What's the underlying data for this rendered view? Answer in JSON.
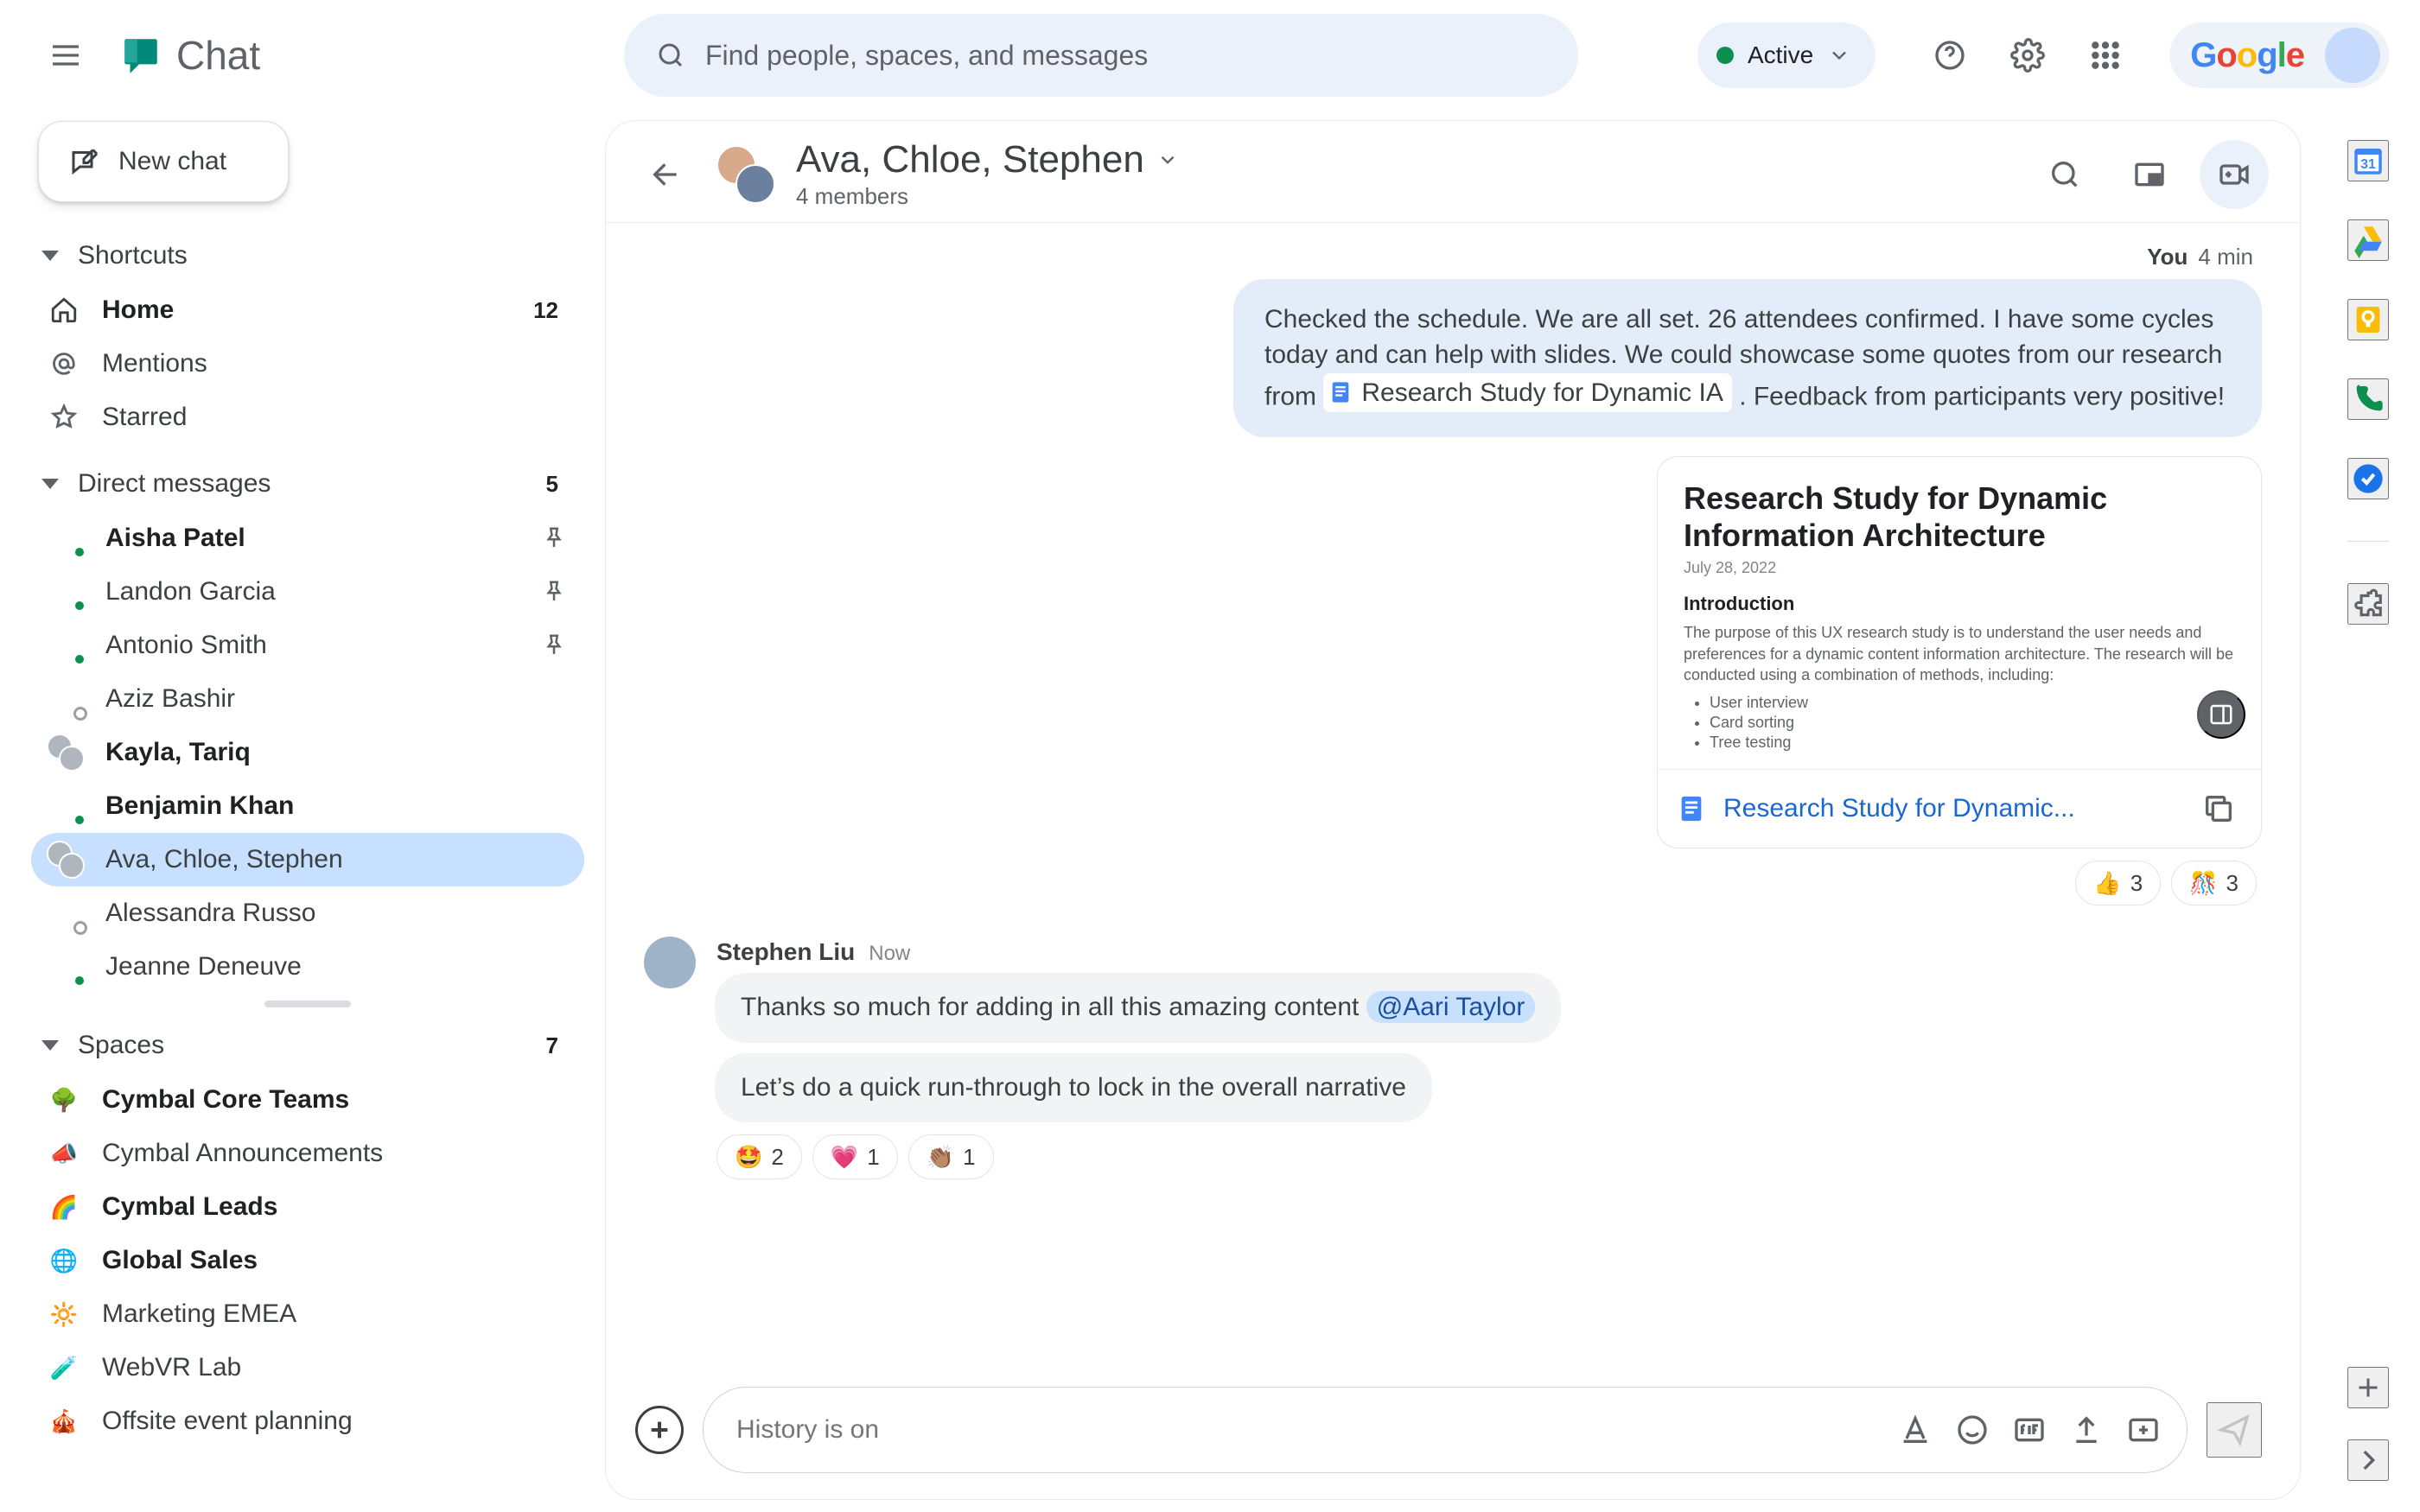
{
  "app_title": "Chat",
  "search": {
    "placeholder": "Find people, spaces, and messages"
  },
  "status": {
    "label": "Active"
  },
  "new_chat_label": "New chat",
  "sections": {
    "shortcuts": {
      "label": "Shortcuts"
    },
    "home": {
      "label": "Home",
      "count": "12"
    },
    "mentions": {
      "label": "Mentions"
    },
    "starred": {
      "label": "Starred"
    },
    "dms": {
      "label": "Direct messages",
      "count": "5"
    },
    "spaces": {
      "label": "Spaces",
      "count": "7"
    }
  },
  "dms": [
    {
      "name": "Aisha Patel",
      "presence": "online",
      "bold": true,
      "pinned": true
    },
    {
      "name": "Landon Garcia",
      "presence": "online",
      "bold": false,
      "pinned": true
    },
    {
      "name": "Antonio Smith",
      "presence": "online",
      "bold": false,
      "pinned": true
    },
    {
      "name": "Aziz Bashir",
      "presence": "offline",
      "bold": false,
      "pinned": false
    },
    {
      "name": "Kayla, Tariq",
      "presence": "pair",
      "bold": true,
      "pinned": false
    },
    {
      "name": "Benjamin Khan",
      "presence": "online",
      "bold": true,
      "pinned": false
    },
    {
      "name": "Ava, Chloe, Stephen",
      "presence": "pair",
      "bold": false,
      "pinned": false,
      "active": true
    },
    {
      "name": "Alessandra Russo",
      "presence": "offline",
      "bold": false,
      "pinned": false
    },
    {
      "name": "Jeanne Deneuve",
      "presence": "online",
      "bold": false,
      "pinned": false
    }
  ],
  "spaces": [
    {
      "name": "Cymbal Core Teams",
      "emoji": "🌳",
      "bold": true
    },
    {
      "name": "Cymbal Announcements",
      "emoji": "📣",
      "bold": false
    },
    {
      "name": "Cymbal Leads",
      "emoji": "🌈",
      "bold": true
    },
    {
      "name": "Global Sales",
      "emoji": "🌐",
      "bold": true
    },
    {
      "name": "Marketing EMEA",
      "emoji": "🔆",
      "bold": false
    },
    {
      "name": "WebVR Lab",
      "emoji": "🧪",
      "bold": false
    },
    {
      "name": "Offsite event planning",
      "emoji": "🎪",
      "bold": false
    }
  ],
  "conversation": {
    "title": "Ava, Chloe, Stephen",
    "subtitle": "4 members",
    "you_label": "You",
    "you_time": "4 min",
    "you_text_before": "Checked the schedule.  We are all set.  26 attendees confirmed. I have some cycles today and can help with slides.  We could showcase some quotes from our research from ",
    "you_chip_label": "Research Study for Dynamic IA",
    "you_text_after": " . Feedback from participants very positive!",
    "card": {
      "title": "Research Study for Dynamic Information Architecture",
      "date": "July 28, 2022",
      "section": "Introduction",
      "para": "The purpose of this UX research study is to understand the user needs and preferences for a dynamic content information architecture. The research will be conducted using a combination of methods, including:",
      "bullets": [
        "User interview",
        "Card sorting",
        "Tree testing"
      ],
      "link": "Research Study for Dynamic..."
    },
    "you_reacts": [
      {
        "emoji": "👍",
        "count": "3"
      },
      {
        "emoji": "🎊",
        "count": "3"
      }
    ],
    "in": {
      "author": "Stephen Liu",
      "time": "Now",
      "line1_before": "Thanks so much for adding in all this amazing content  ",
      "mention": "@Aari Taylor",
      "line2": "Let’s do a quick run-through to lock in the overall narrative",
      "reacts": [
        {
          "emoji": "🤩",
          "count": "2"
        },
        {
          "emoji": "💗",
          "count": "1"
        },
        {
          "emoji": "👏🏽",
          "count": "1"
        }
      ]
    },
    "compose_placeholder": "History is on"
  }
}
